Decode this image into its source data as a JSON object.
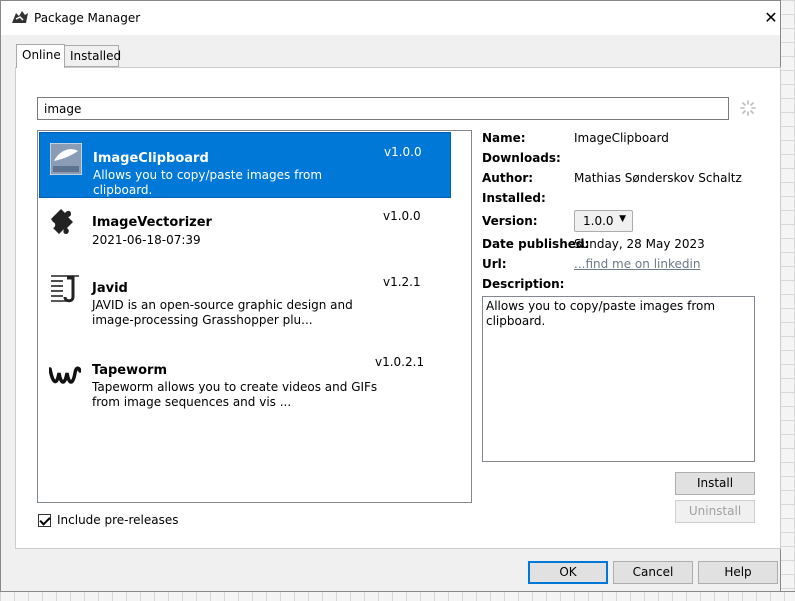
{
  "window": {
    "title": "Package Manager",
    "close_glyph": "✕"
  },
  "tabs": [
    {
      "label": "Online"
    },
    {
      "label": "Installed"
    }
  ],
  "search": {
    "value": "image"
  },
  "packages": [
    {
      "name": "ImageClipboard",
      "description": "Allows you to copy/paste images from clipboard.",
      "version": "v1.0.0",
      "icon": "image-clipboard-icon"
    },
    {
      "name": "ImageVectorizer",
      "description": "2021-06-18-07:39",
      "version": "v1.0.0",
      "icon": "puzzle-piece-icon"
    },
    {
      "name": "Javid",
      "description": "JAVID is an open-source graphic design and image-processing Grasshopper plu...",
      "version": "v1.2.1",
      "icon": "javid-logo-icon"
    },
    {
      "name": "Tapeworm",
      "description": "Tapeworm allows you to create videos and GIFs from image sequences and vis ...",
      "version": "v1.0.2.1",
      "icon": "tapeworm-logo-icon"
    }
  ],
  "prerelease": {
    "label": "Include pre-releases",
    "checked": true
  },
  "details": {
    "name_label": "Name:",
    "name_value": "ImageClipboard",
    "downloads_label": "Downloads:",
    "author_label": "Author:",
    "author_value": "Mathias Sønderskov Schaltz",
    "installed_label": "Installed:",
    "version_label": "Version:",
    "version_value": "1.0.0",
    "date_label": "Date published:",
    "date_value": "Sunday, 28 May 2023",
    "url_label": "Url:",
    "url_value": "...find me on linkedin",
    "description_label": "Description:",
    "description_value": "Allows you to copy/paste images from clipboard."
  },
  "buttons": {
    "install": "Install",
    "uninstall": "Uninstall",
    "ok": "OK",
    "cancel": "Cancel",
    "help": "Help"
  },
  "colors": {
    "selection": "#0078d7",
    "link": "#6d7a8a"
  }
}
